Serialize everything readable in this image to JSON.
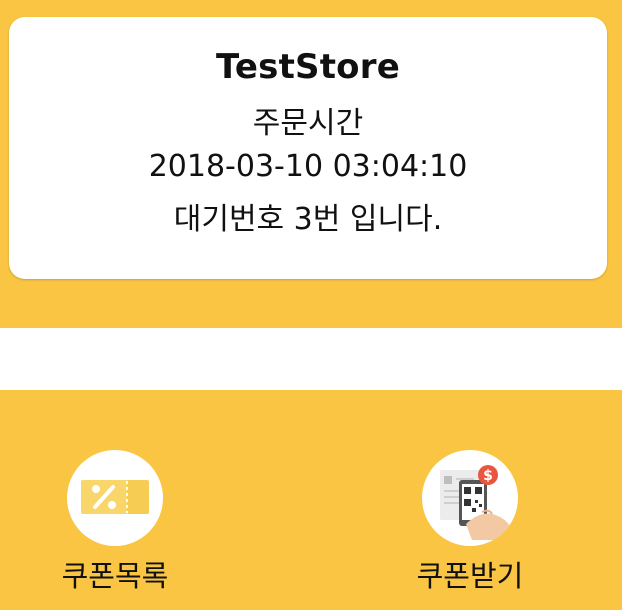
{
  "order": {
    "store_name": "TestStore",
    "order_time_label": "주문시간",
    "order_time_value": "2018-03-10 03:04:10",
    "queue_message": "대기번호 3번 입니다."
  },
  "menu": {
    "coupon_list_label": "쿠폰목록",
    "coupon_get_label": "쿠폰받기"
  },
  "icons": {
    "coupon_list": "coupon-ticket-icon",
    "coupon_get": "phone-qr-coupon-icon"
  },
  "colors": {
    "background": "#F9C543",
    "card": "#FFFFFF",
    "ticket": "#F9D66A",
    "badge": "#E9563F"
  }
}
